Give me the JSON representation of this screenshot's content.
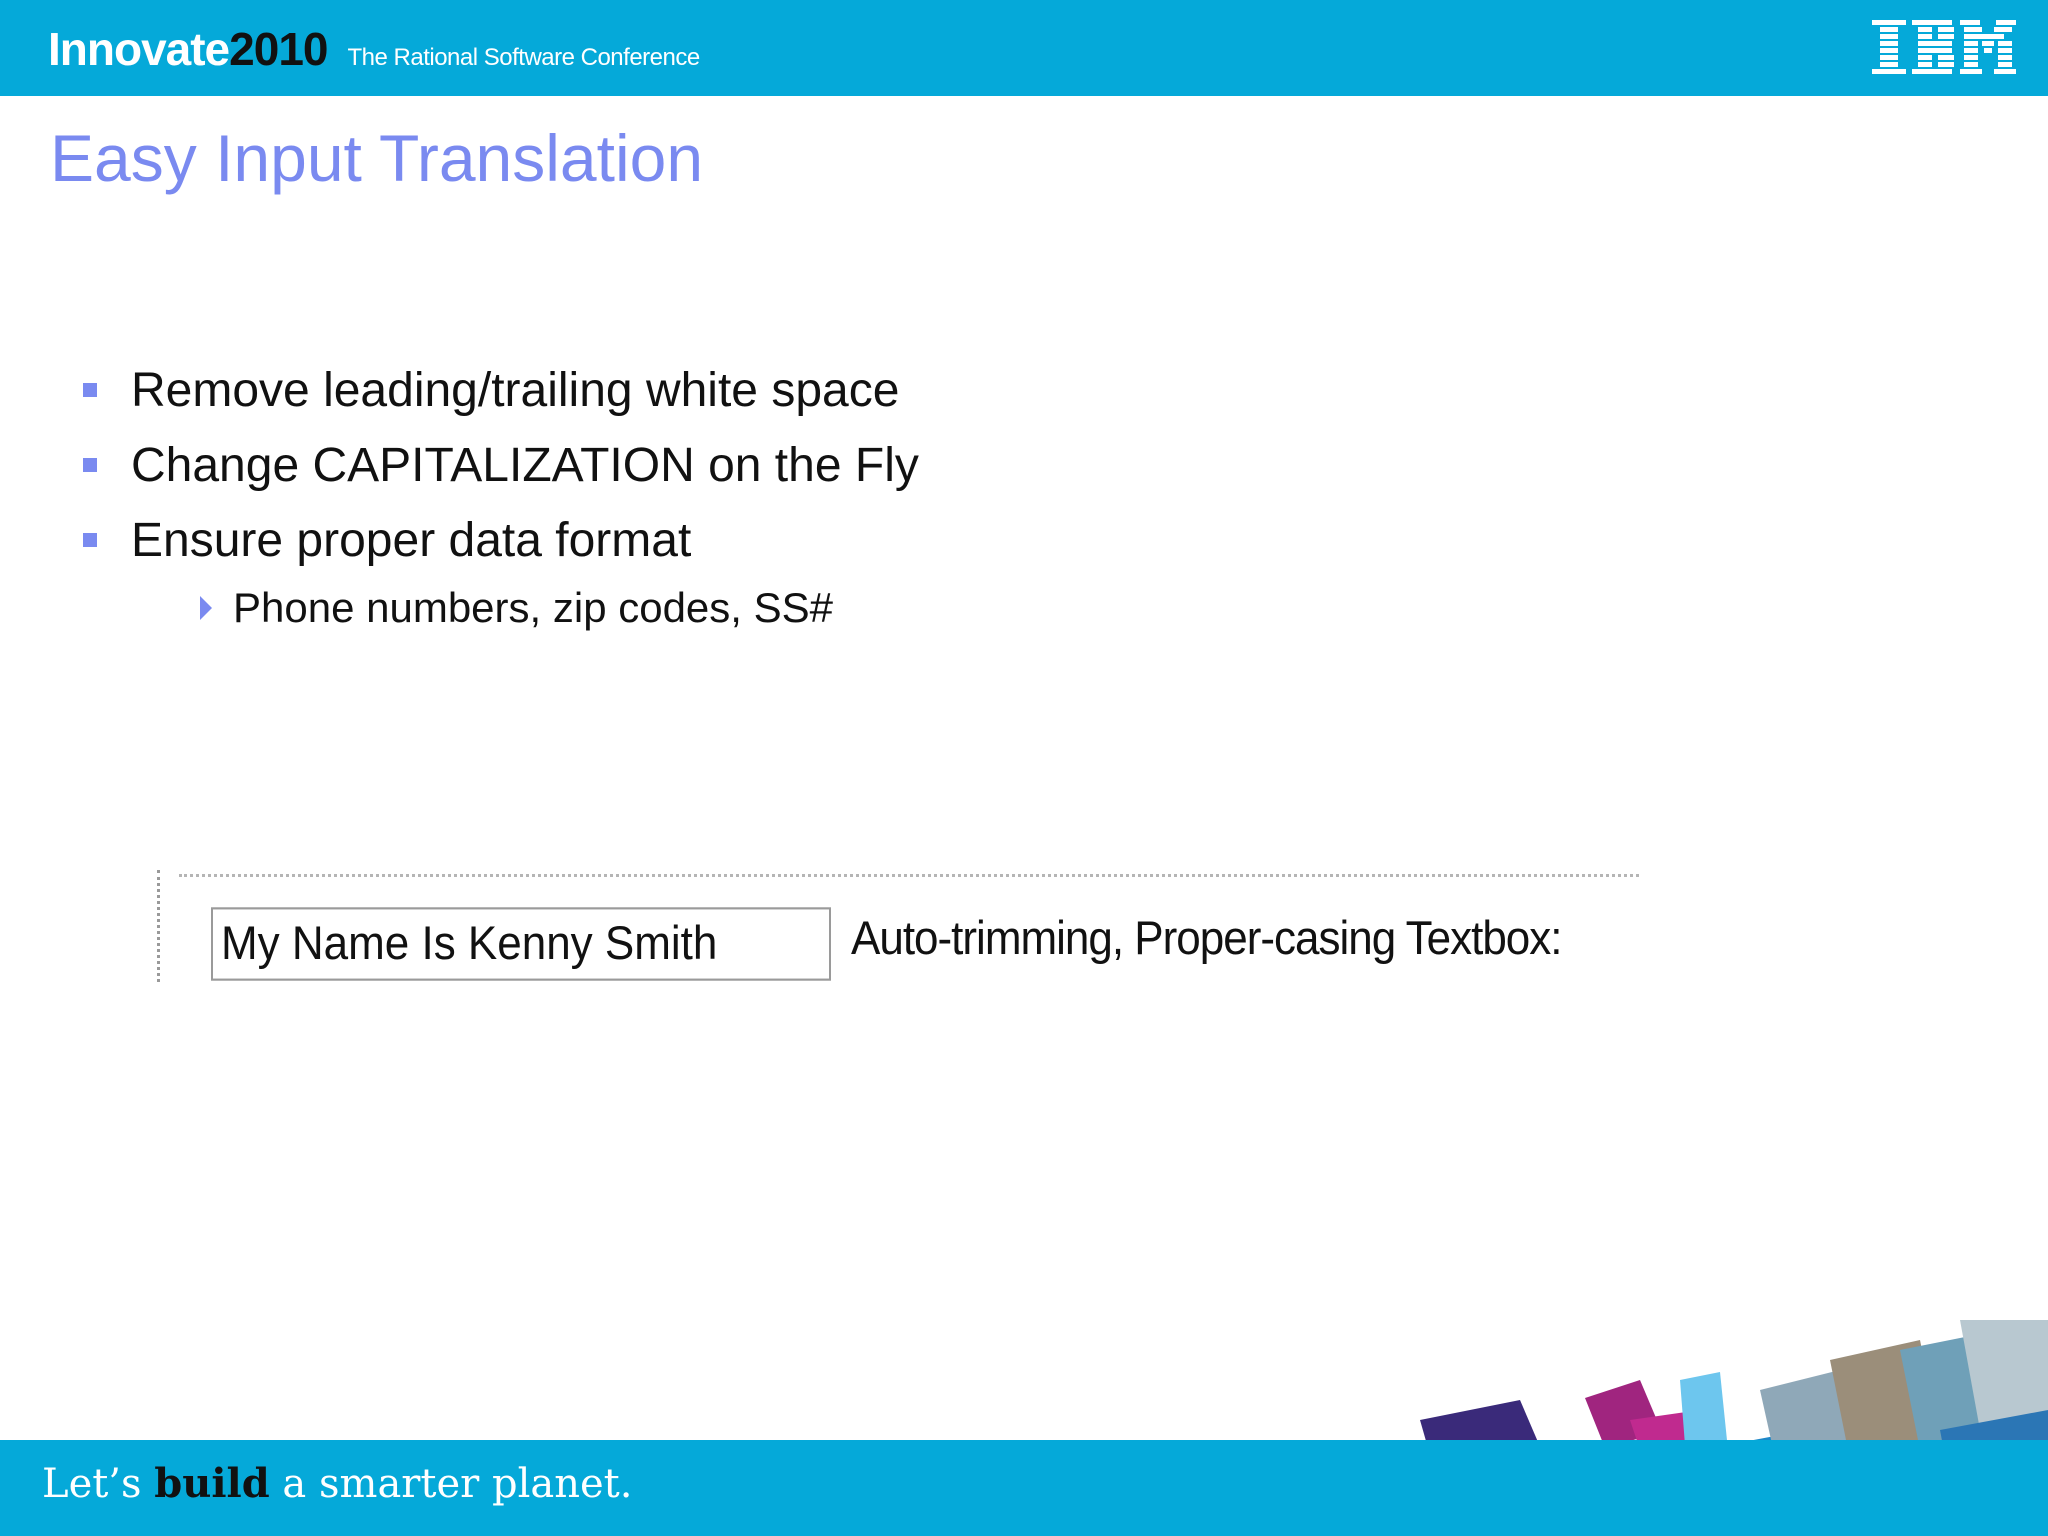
{
  "header": {
    "brand_innovate": "Innovate",
    "brand_year": "2010",
    "tagline": "The Rational Software Conference",
    "ibm_logo_icon": "ibm-logo"
  },
  "slide": {
    "title": "Easy Input Translation",
    "bullets": [
      "Remove leading/trailing white space",
      "Change CAPITALIZATION on the Fly",
      "Ensure proper data format"
    ],
    "sub_bullets": [
      "Phone numbers, zip codes, SS#"
    ]
  },
  "demo": {
    "input_value": "My Name Is Kenny Smith",
    "label": "Auto-trimming, Proper-casing Textbox:"
  },
  "footer": {
    "slogan_part1": "Let’s",
    "slogan_bold": "build",
    "slogan_part2": "a smarter planet."
  },
  "colors": {
    "brand_blue": "#05a9d9",
    "title_color": "#7a8af0"
  }
}
